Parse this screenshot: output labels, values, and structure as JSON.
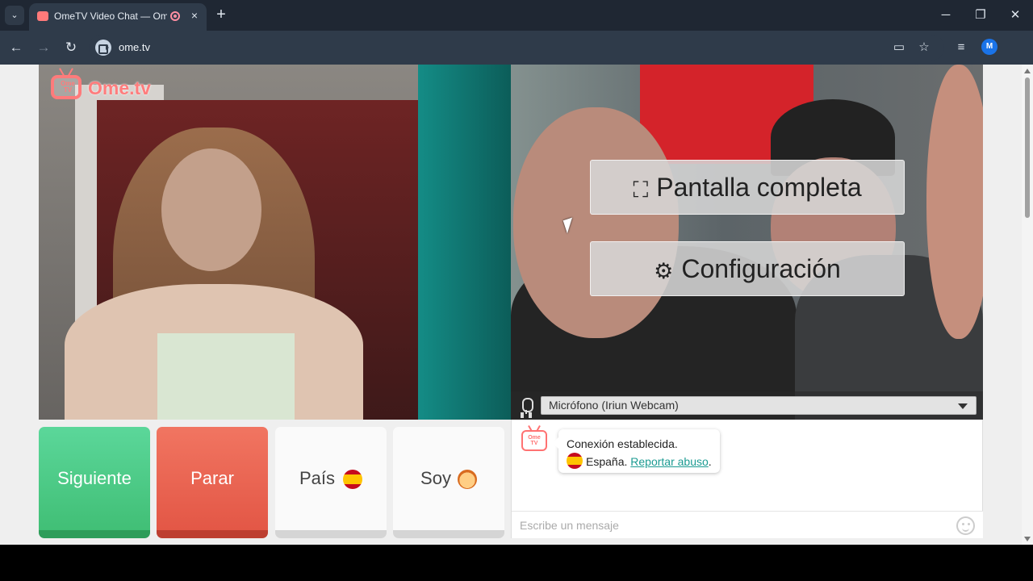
{
  "browser": {
    "tab": {
      "title": "OmeTV Video Chat — Ome",
      "close": "×"
    },
    "new_tab": "+",
    "window_controls": {
      "minimize": "─",
      "maximize": "❐",
      "close": "✕"
    },
    "nav": {
      "back": "←",
      "forward": "→",
      "reload": "↻"
    },
    "address_bar": {
      "url": "ome.tv"
    },
    "profile_initial": "M"
  },
  "page": {
    "logo": {
      "box_text": "Ome TV",
      "wordmark": "Ome.tv"
    },
    "overlay_buttons": {
      "fullscreen": "Pantalla completa",
      "settings": "Configuración"
    },
    "microphone": {
      "selected": "Micrófono (Iriun Webcam)"
    },
    "controls": {
      "next": "Siguiente",
      "stop": "Parar",
      "country": "País",
      "gender": "Soy"
    },
    "chat": {
      "logo_text": "Ome TV",
      "connection": "Conexión establecida.",
      "country": "España.",
      "report": "Reportar abuso",
      "period": ".",
      "placeholder": "Escribe un mensaje"
    }
  },
  "colors": {
    "next": "#4ccb85",
    "stop": "#e86552",
    "brand": "#ff7b7b",
    "link": "#1c9b92"
  },
  "icons": [
    "tab-list-icon",
    "video-chat-site-icon",
    "recording-icon",
    "cast-icon",
    "bookmark-star-icon",
    "media-controls-icon",
    "fullscreen-icon",
    "gear-icon",
    "microphone-icon",
    "chevron-down-icon",
    "spain-flag-icon",
    "boy-emoji-icon",
    "emoji-icon"
  ]
}
